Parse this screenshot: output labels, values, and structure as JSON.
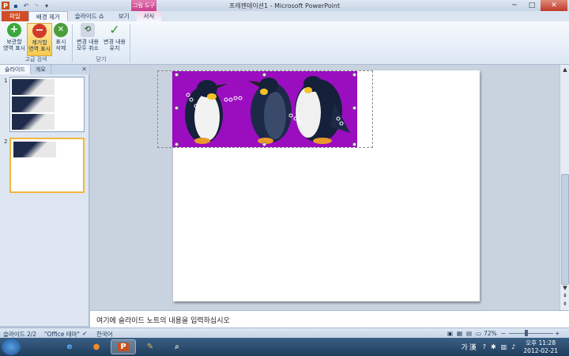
{
  "app": {
    "title": "프레젠테이션1 - Microsoft PowerPoint",
    "context_group": "그림 도구"
  },
  "window_controls": {
    "minimize": "─",
    "maximize": "□",
    "close": "✕"
  },
  "tabs": [
    {
      "label": "파일"
    },
    {
      "label": "배경 제거"
    },
    {
      "label": "슬라이드 쇼"
    },
    {
      "label": "보기"
    },
    {
      "label": "서식"
    }
  ],
  "ribbon": {
    "buttons": [
      {
        "label1": "보관할",
        "label2": "영역 표시",
        "icon": "plus-green-icon"
      },
      {
        "label1": "제거할",
        "label2": "영역 표시",
        "icon": "minus-red-icon"
      },
      {
        "label1": "표시",
        "label2": "삭제",
        "icon": "delete-mark-icon"
      },
      {
        "label1": "변경 내용",
        "label2": "모두 취소",
        "icon": "discard-icon"
      },
      {
        "label1": "변경 내용",
        "label2": "유지",
        "icon": "checkmark-icon"
      }
    ],
    "groups": [
      {
        "label": "고급 검색"
      },
      {
        "label": "닫기"
      }
    ]
  },
  "left_pane": {
    "tabs": [
      {
        "label": "슬라이드"
      },
      {
        "label": "개요"
      }
    ],
    "close": "✕",
    "slides": [
      {
        "num": "1"
      },
      {
        "num": "2"
      }
    ]
  },
  "notes": {
    "placeholder": "여기에 슬라이드 노트의 내용을 입력하십시오"
  },
  "status": {
    "slide": "슬라이드 2/2",
    "theme": "\"Office 테마\"",
    "language": "한국어",
    "zoom": "72%"
  },
  "tray": {
    "ime": "가",
    "han": "漢",
    "time": "오후 11:28",
    "date": "2012-02-21"
  },
  "colors": {
    "picture_bg": "#9a0ec0",
    "file_tab": "#d04e27",
    "context_group": "#c73f8c"
  }
}
